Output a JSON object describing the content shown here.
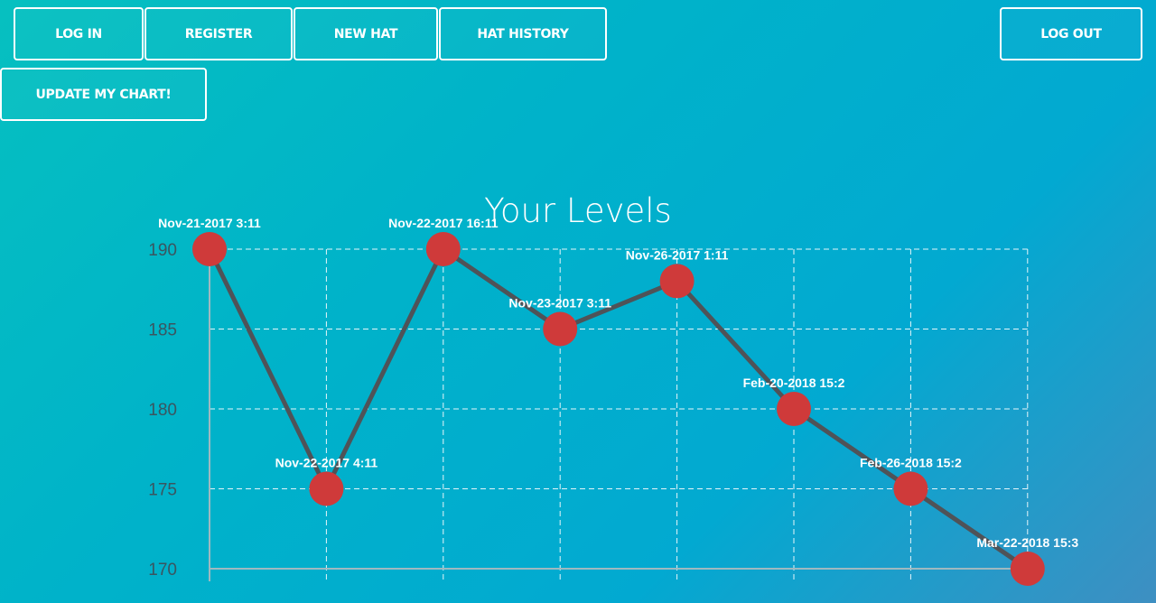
{
  "nav": {
    "login_label": "LOG IN",
    "register_label": "REGISTER",
    "new_hat_label": "NEW HAT",
    "hat_history_label": "HAT HISTORY",
    "logout_label": "LOG OUT",
    "update_chart_label": "UPDATE MY CHART!"
  },
  "colors": {
    "line": "#4f5358",
    "point": "#cf3a3a",
    "grid": "#e6f6fa",
    "axis": "#9fb9c0"
  },
  "chart_data": {
    "type": "line",
    "title": "Your Levels",
    "xlabel": "",
    "ylabel": "",
    "categories": [
      "Nov-21-2017 3:11",
      "Nov-22-2017 4:11",
      "Nov-22-2017 16:11",
      "Nov-23-2017 3:11",
      "Nov-26-2017 1:11",
      "Feb-20-2018 15:2",
      "Feb-26-2018 15:2",
      "Mar-22-2018 15:3"
    ],
    "values": [
      190,
      175,
      190,
      185,
      188,
      180,
      175,
      170
    ],
    "ylim": [
      170,
      190
    ],
    "yticks": [
      190,
      185,
      180,
      175,
      170
    ],
    "grid": true,
    "legend": "none"
  }
}
